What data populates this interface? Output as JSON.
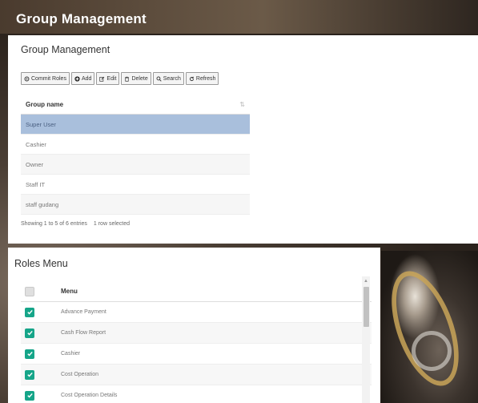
{
  "page": {
    "title": "Group Management"
  },
  "group_card": {
    "title": "Group Management",
    "toolbar": [
      {
        "label": "Commit Roles",
        "icon": "cog-icon"
      },
      {
        "label": "Add",
        "icon": "plus-circle-icon"
      },
      {
        "label": "Edit",
        "icon": "edit-icon"
      },
      {
        "label": "Delete",
        "icon": "trash-icon"
      },
      {
        "label": "Search",
        "icon": "search-icon"
      },
      {
        "label": "Refresh",
        "icon": "refresh-icon"
      }
    ],
    "table": {
      "column": "Group name",
      "rows": [
        "Super User",
        "Cashier",
        "Owner",
        "Staff IT",
        "staff gudang"
      ],
      "selected_index": 0
    },
    "footer": {
      "entries": "Showing 1 to 5 of 6 entries",
      "selection": "1 row selected"
    }
  },
  "roles_card": {
    "title": "Roles Menu",
    "column": "Menu",
    "rows": [
      {
        "label": "Advance Payment",
        "checked": true
      },
      {
        "label": "Cash Flow Report",
        "checked": true
      },
      {
        "label": "Cashier",
        "checked": true
      },
      {
        "label": "Cost Operation",
        "checked": true
      },
      {
        "label": "Cost Operation Details",
        "checked": true
      }
    ]
  },
  "colors": {
    "selected_row": "#a9bfdc",
    "checkbox_on": "#16a589"
  }
}
